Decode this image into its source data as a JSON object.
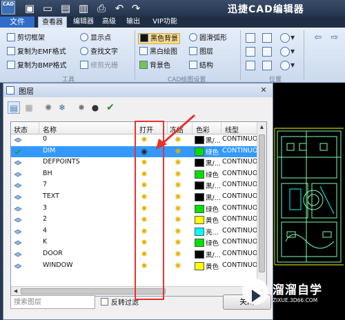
{
  "app": {
    "logo_text": "CAD",
    "title": "迅捷CAD编辑器"
  },
  "menu": {
    "file": "文件",
    "tabs": [
      "查看器",
      "编辑器",
      "高级",
      "输出",
      "VIP功能"
    ],
    "active_tab": "查看器"
  },
  "ribbon": {
    "tools_group": {
      "label": "工具",
      "items": [
        "剪切框架",
        "复制为EMF格式",
        "复制为BMP格式",
        "显示点",
        "查找文字",
        "修剪光栅"
      ]
    },
    "cad_group": {
      "label": "CAD绘图设置",
      "items": [
        "黑色背景",
        "黑白绘图",
        "背景色",
        "圆滑弧形",
        "图层",
        "结构"
      ]
    },
    "position_group": {
      "label": "位置"
    }
  },
  "dialog": {
    "title": "图层",
    "close_glyph": "✕",
    "columns": [
      "状态",
      "名称",
      "打开",
      "冻结",
      "色彩",
      "线型"
    ],
    "layers": [
      {
        "name": "0",
        "color_name": "黑/...",
        "color": "#000000",
        "linetype": "CONTINUOUS",
        "current": false,
        "visible": true
      },
      {
        "name": "DIM",
        "color_name": "绿色",
        "color": "#00e000",
        "linetype": "CONTINUOUS",
        "current": true,
        "visible": false
      },
      {
        "name": "DEFPOINTS",
        "color_name": "黑/...",
        "color": "#000000",
        "linetype": "CONTINUOUS",
        "current": false,
        "visible": true
      },
      {
        "name": "BH",
        "color_name": "绿色",
        "color": "#00e000",
        "linetype": "CONTINUOUS",
        "current": false,
        "visible": true
      },
      {
        "name": "7",
        "color_name": "黑/...",
        "color": "#000000",
        "linetype": "CONTINUOUS",
        "current": false,
        "visible": true
      },
      {
        "name": "TEXT",
        "color_name": "黑/...",
        "color": "#000000",
        "linetype": "CONTINUOUS",
        "current": false,
        "visible": true
      },
      {
        "name": "3",
        "color_name": "绿色",
        "color": "#00e000",
        "linetype": "CONTINUOUS",
        "current": false,
        "visible": true
      },
      {
        "name": "2",
        "color_name": "黄色",
        "color": "#ffff00",
        "linetype": "CONTINUOUS",
        "current": false,
        "visible": true
      },
      {
        "name": "4",
        "color_name": "亮...",
        "color": "#00ffff",
        "linetype": "CONTINUOUS",
        "current": false,
        "visible": true
      },
      {
        "name": "K",
        "color_name": "绿色",
        "color": "#00e000",
        "linetype": "CONTINUOUS",
        "current": false,
        "visible": true
      },
      {
        "name": "DOOR",
        "color_name": "黑/...",
        "color": "#000000",
        "linetype": "CONTINUOUS",
        "current": false,
        "visible": true
      },
      {
        "name": "WINDOW",
        "color_name": "黄色",
        "color": "#ffff00",
        "linetype": "CONTINUOUS",
        "current": false,
        "visible": true
      }
    ],
    "search_placeholder": "搜索图层",
    "invert_filter_label": "反转过滤",
    "close_button": "关闭"
  },
  "watermark": {
    "title": "溜溜自学",
    "subtitle": "ZIXUE.3D66.COM"
  }
}
